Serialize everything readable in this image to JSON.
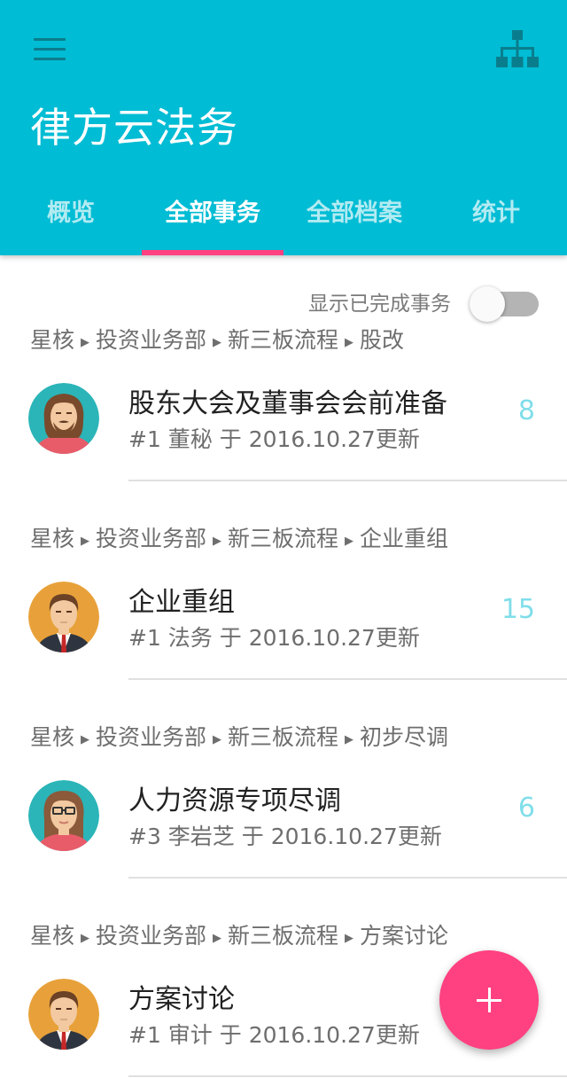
{
  "app": {
    "title": "律方云法务"
  },
  "icons": {
    "menu": "menu-icon",
    "org": "org-chart-icon",
    "fab": "plus-icon"
  },
  "colors": {
    "primary": "#00bcd4",
    "accent": "#ff4081",
    "count": "#80deea"
  },
  "tabs": [
    {
      "label": "概览",
      "active": false
    },
    {
      "label": "全部事务",
      "active": true
    },
    {
      "label": "全部档案",
      "active": false
    },
    {
      "label": "统计",
      "active": false
    }
  ],
  "filter": {
    "label": "显示已完成事务",
    "on": false
  },
  "items": [
    {
      "breadcrumb": [
        "星核",
        "投资业务部",
        "新三板流程",
        "股改"
      ],
      "title": "股东大会及董事会会前准备",
      "subtitle": "#1 董秘 于 2016.10.27更新",
      "count": "8",
      "avatar": "bearded-man-avatar"
    },
    {
      "breadcrumb": [
        "星核",
        "投资业务部",
        "新三板流程",
        "企业重组"
      ],
      "title": "企业重组",
      "subtitle": "#1 法务 于 2016.10.27更新",
      "count": "15",
      "avatar": "businessman-avatar"
    },
    {
      "breadcrumb": [
        "星核",
        "投资业务部",
        "新三板流程",
        "初步尽调"
      ],
      "title": "人力资源专项尽调",
      "subtitle": "#3 李岩芝 于 2016.10.27更新",
      "count": "6",
      "avatar": "woman-glasses-avatar"
    },
    {
      "breadcrumb": [
        "星核",
        "投资业务部",
        "新三板流程",
        "方案讨论"
      ],
      "title": "方案讨论",
      "subtitle": "#1 审计 于 2016.10.27更新",
      "count": "",
      "avatar": "businessman-avatar"
    }
  ]
}
